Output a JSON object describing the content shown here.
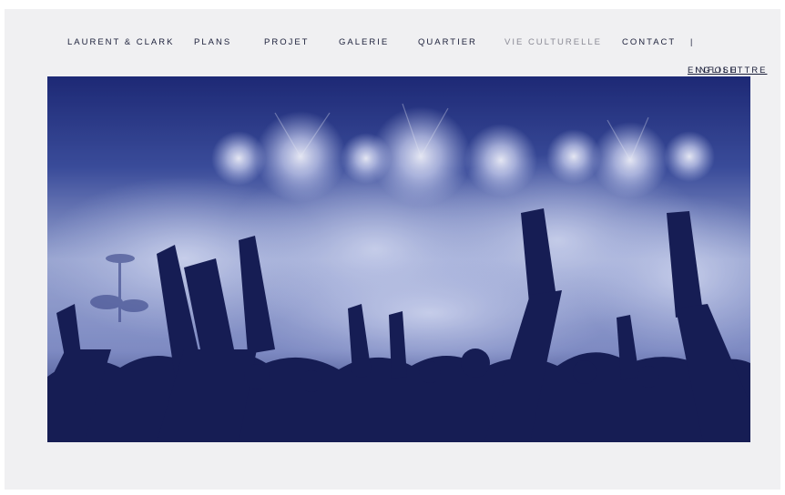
{
  "brand": "LAURENT & CLARK",
  "nav": {
    "plans": "PLANS",
    "projet": "PROJET",
    "galerie": "GALERIE",
    "quartier": "QUARTIER",
    "vie_culturelle": "VIE CULTURELLE",
    "contact": "CONTACT"
  },
  "utility": {
    "english": "English",
    "separator": "|",
    "infolettre": "Infolettre"
  },
  "colors": {
    "background": "#f0f0f2",
    "nav_text": "#1b1f3a",
    "nav_active": "#8a8a95",
    "hero_tint": "#1a2159"
  },
  "hero": {
    "image": "concert-crowd-photo"
  }
}
